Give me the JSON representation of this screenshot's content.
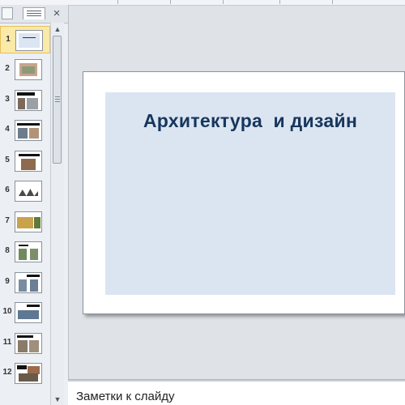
{
  "slides_panel": {
    "close_glyph": "×",
    "thumbnails": [
      {
        "number": "1",
        "selected": true
      },
      {
        "number": "2",
        "selected": false
      },
      {
        "number": "3",
        "selected": false
      },
      {
        "number": "4",
        "selected": false
      },
      {
        "number": "5",
        "selected": false
      },
      {
        "number": "6",
        "selected": false
      },
      {
        "number": "7",
        "selected": false
      },
      {
        "number": "8",
        "selected": false
      },
      {
        "number": "9",
        "selected": false
      },
      {
        "number": "10",
        "selected": false
      },
      {
        "number": "11",
        "selected": false
      },
      {
        "number": "12",
        "selected": false
      }
    ]
  },
  "scrollbar": {
    "up_arrow": "▲",
    "down_arrow": "▼"
  },
  "slide": {
    "title": "Архитектура  и дизайн"
  },
  "notes": {
    "placeholder": "Заметки к слайду"
  },
  "colors": {
    "selected_thumb": "#fbe9a8",
    "title_text": "#17365d",
    "slide_box": "#dbe5f1"
  }
}
